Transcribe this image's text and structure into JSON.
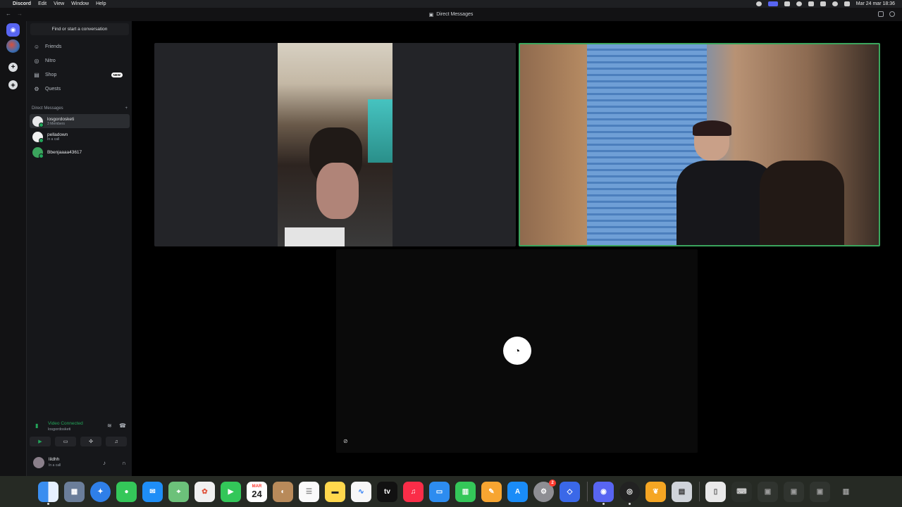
{
  "menubar": {
    "app": "Discord",
    "items": [
      "Edit",
      "View",
      "Window",
      "Help"
    ],
    "date_time": "Mar 24 mar  18:36"
  },
  "titlebar": {
    "title": "Direct Messages"
  },
  "sidebar": {
    "search_placeholder": "Find or start a conversation",
    "nav": [
      {
        "label": "Friends",
        "icon": "friends-icon"
      },
      {
        "label": "Nitro",
        "icon": "nitro-icon"
      },
      {
        "label": "Shop",
        "icon": "shop-icon",
        "badge": "NEW"
      },
      {
        "label": "Quests",
        "icon": "quests-icon"
      }
    ],
    "dm_header": "Direct Messages",
    "dm_add": "+",
    "dms": [
      {
        "name": "losgordosketi",
        "sub": "3 Members",
        "active": true
      },
      {
        "name": "pelladown",
        "sub": "In a call"
      },
      {
        "name": "Bbenjaaaa43617",
        "sub": ""
      }
    ]
  },
  "voice": {
    "status": "Video Connected",
    "channel": "losgordosketi"
  },
  "user": {
    "name": "lildhh",
    "status": "In a call"
  },
  "dock": {
    "calendar_month": "MAR",
    "calendar_day": "24",
    "settings_badge": "2",
    "appletv_label": "tv"
  },
  "colors": {
    "accent": "#5865f2",
    "online": "#23a55a",
    "speaking_border": "#3ba55d"
  }
}
